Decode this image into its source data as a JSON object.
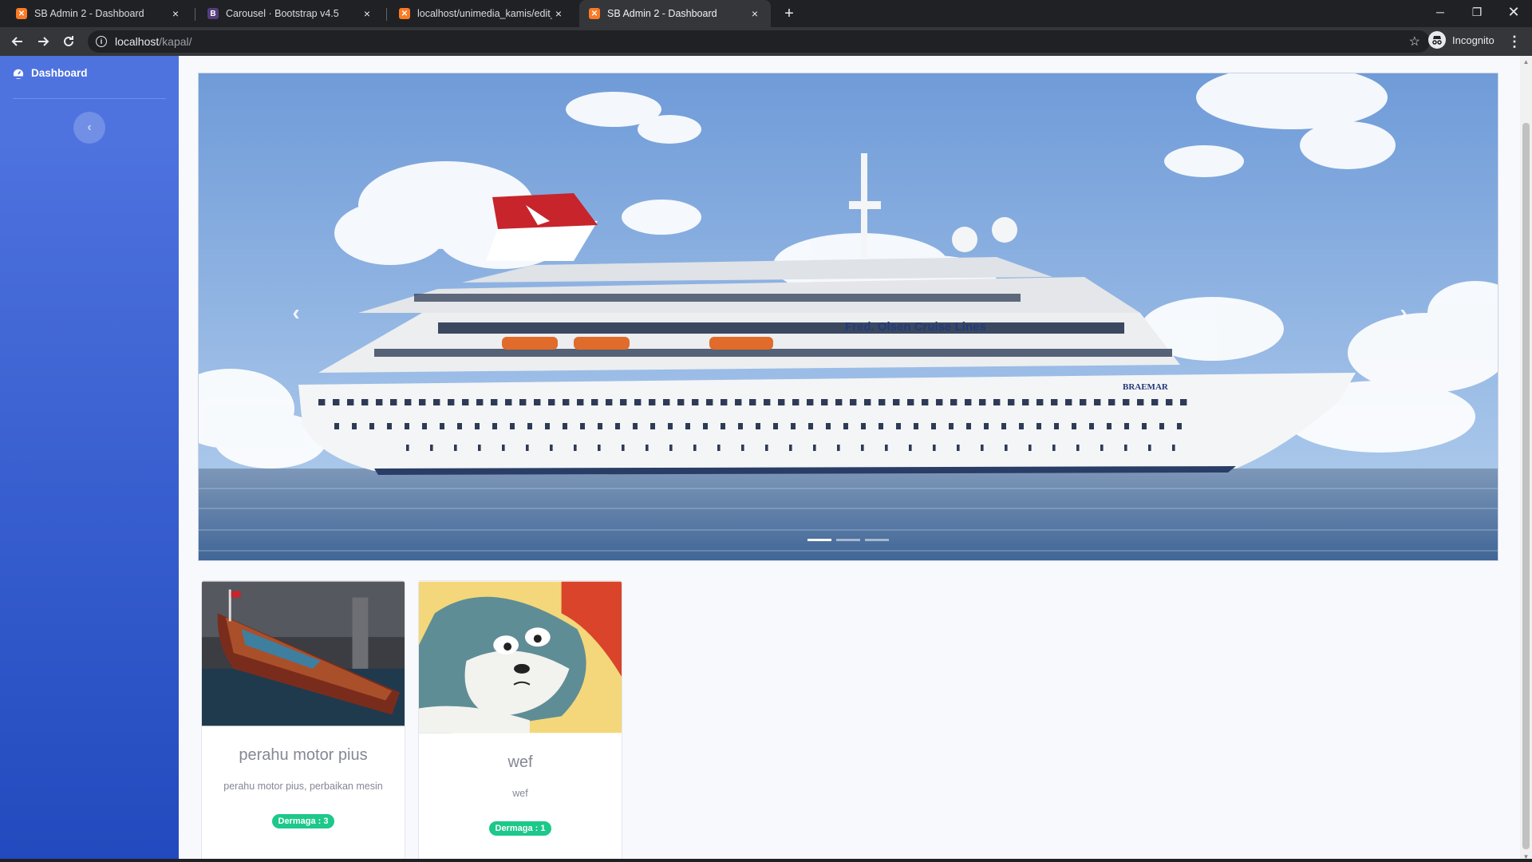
{
  "browser": {
    "tabs": [
      {
        "title": "SB Admin 2 - Dashboard",
        "icon": "xampp-icon"
      },
      {
        "title": "Carousel · Bootstrap v4.5",
        "icon": "bootstrap-icon"
      },
      {
        "title": "localhost/unimedia_kamis/edit_f",
        "icon": "xampp-icon"
      },
      {
        "title": "SB Admin 2 - Dashboard",
        "icon": "xampp-icon"
      }
    ],
    "active_tab": 3,
    "url_host": "localhost",
    "url_path": "/kapal/",
    "profile_label": "Incognito"
  },
  "sidebar": {
    "dashboard_label": "Dashboard"
  },
  "carousel": {
    "slide_count": 3,
    "active_slide": 0,
    "ship_text": "Fred. Olsen Cruise Lines",
    "ship_name": "BRAEMAR"
  },
  "cards": [
    {
      "title": "perahu motor pius",
      "text": "perahu motor pius, perbaikan mesin",
      "badge": "Dermaga : 3"
    },
    {
      "title": "wef",
      "text": "wef",
      "badge": "Dermaga : 1"
    }
  ],
  "colors": {
    "sidebar_top": "#4e73df",
    "sidebar_bottom": "#224abe",
    "badge_green": "#1cc88a",
    "page_bg": "#f8f9fc"
  }
}
